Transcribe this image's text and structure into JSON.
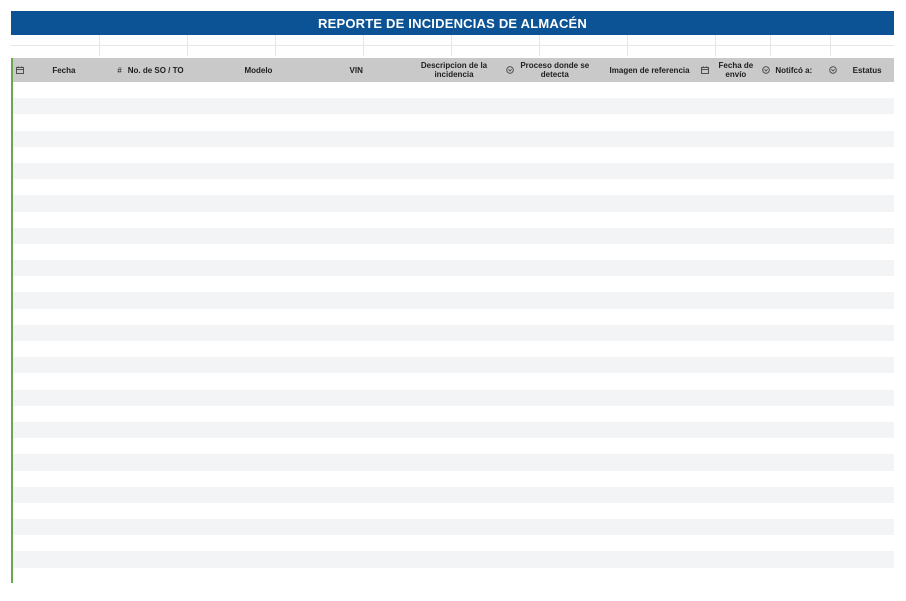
{
  "sheet": {
    "title": "REPORTE DE INCIDENCIAS DE ALMACÉN",
    "accent_color": "#0b5394",
    "header_bg": "#c9c9c9",
    "stripe_color": "#f3f4f6",
    "frozen_border_color": "#6aa84f"
  },
  "columns": [
    {
      "label": "Fecha",
      "icon": "calendar-icon"
    },
    {
      "label": "#",
      "icon": ""
    },
    {
      "label": "No. de SO / TO",
      "icon": ""
    },
    {
      "label": "Modelo",
      "icon": ""
    },
    {
      "label": "VIN",
      "icon": ""
    },
    {
      "label": "Descripcion de la incidencia",
      "icon": ""
    },
    {
      "label": "Proceso donde se detecta",
      "icon": "dropdown-icon"
    },
    {
      "label": "Imagen de referencia",
      "icon": ""
    },
    {
      "label": "Fecha de envío",
      "icon": "calendar-icon"
    },
    {
      "label": "Notifcó a:",
      "icon": "dropdown-icon"
    },
    {
      "label": "Estatus",
      "icon": "dropdown-icon"
    }
  ]
}
